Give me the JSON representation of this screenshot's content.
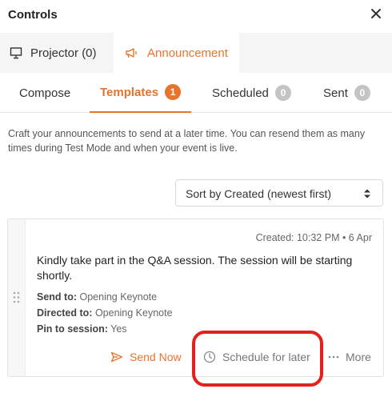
{
  "window": {
    "title": "Controls"
  },
  "main_tabs": [
    {
      "label": "Projector (0)",
      "icon": "projector-icon"
    },
    {
      "label": "Announcement",
      "icon": "megaphone-icon"
    }
  ],
  "sub_tabs": {
    "compose": {
      "label": "Compose"
    },
    "templates": {
      "label": "Templates",
      "count": "1"
    },
    "scheduled": {
      "label": "Scheduled",
      "count": "0"
    },
    "sent": {
      "label": "Sent",
      "count": "0"
    }
  },
  "description": "Craft your announcements to send at a later time. You can resend them as many times during Test Mode and when your event is live.",
  "sort": {
    "selected": "Sort by Created (newest first)"
  },
  "template_card": {
    "created": "Created: 10:32 PM • 6 Apr",
    "message": "Kindly take part in the Q&A session. The session will be starting shortly.",
    "send_to_label": "Send to:",
    "send_to_value": "Opening Keynote",
    "directed_to_label": "Directed to:",
    "directed_to_value": "Opening Keynote",
    "pin_label": "Pin to session:",
    "pin_value": "Yes",
    "send_now": "Send Now",
    "schedule": "Schedule for later",
    "more": "More"
  },
  "colors": {
    "accent": "#e8742c",
    "highlight": "#e3201b",
    "badge_inactive": "#c4c4c4"
  }
}
